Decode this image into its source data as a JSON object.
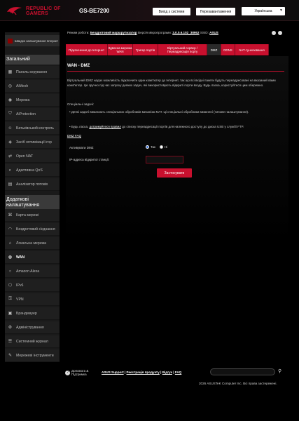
{
  "header": {
    "brand_line1": "REPUBLIC OF",
    "brand_line2": "GAMERS",
    "model": "GS-BE7200",
    "logout": "Вихід з системи",
    "reboot": "Перезавантаження",
    "language": "Українська"
  },
  "info": {
    "mode_label": "Режим роботи:",
    "mode_value": "Бездротовий маршрутизатор",
    "firmware_label": "Версія мікропрограми:",
    "firmware_value": "3.0.0.6.102_38952",
    "ssid_label": "SSID:",
    "ssid_value": "ASUS"
  },
  "sidebar": {
    "quick_setup": "Швидке налаштування Інтернет",
    "general_title": "Загальний",
    "general": [
      {
        "label": "Панель керування",
        "icon": "dashboard-icon"
      },
      {
        "label": "AiMesh",
        "icon": "aimesh-icon"
      },
      {
        "label": "Мережа",
        "icon": "network-icon"
      },
      {
        "label": "AiProtection",
        "icon": "shield-icon"
      },
      {
        "label": "Батьківський контроль",
        "icon": "parental-icon"
      },
      {
        "label": "Засіб оптимізації ігор",
        "icon": "gamepad-icon"
      },
      {
        "label": "Open NAT",
        "icon": "nat-icon"
      },
      {
        "label": "Адаптивна QoS",
        "icon": "qos-icon"
      },
      {
        "label": "Аналізатор потоків",
        "icon": "traffic-icon"
      }
    ],
    "advanced_title": "Додаткові налаштування",
    "advanced": [
      {
        "label": "Карта мережі",
        "icon": "map-icon"
      },
      {
        "label": "Бездротовий з'єднання",
        "icon": "wifi-icon"
      },
      {
        "label": "Локальна мережа",
        "icon": "lan-icon"
      },
      {
        "label": "WAN",
        "icon": "globe-icon",
        "active": true
      },
      {
        "label": "Amazon Alexa",
        "icon": "alexa-icon"
      },
      {
        "label": "IPv6",
        "icon": "ipv6-icon"
      },
      {
        "label": "VPN",
        "icon": "vpn-icon"
      },
      {
        "label": "Брандмауер",
        "icon": "firewall-icon"
      },
      {
        "label": "Адміністрування",
        "icon": "admin-icon"
      },
      {
        "label": "Системний журнал",
        "icon": "log-icon"
      },
      {
        "label": "Мережеві інструменти",
        "icon": "tools-icon"
      }
    ]
  },
  "tabs": [
    {
      "label": "Підключення до Інтернет"
    },
    {
      "label": "Здвоєна мережа WAN"
    },
    {
      "label": "Тригер портів"
    },
    {
      "label": "Віртуальний сервер / Переадресація порту"
    },
    {
      "label": "DMZ",
      "active": true
    },
    {
      "label": "DDNS"
    },
    {
      "label": "NAT-тунелювання"
    }
  ],
  "content": {
    "title": "WAN - DMZ",
    "description": "Віртуальний DMZ надає можливість підключити один комп'ютер до Інтернет, так що всі вхідні пакети будуть переадресовані на вказаний вами комп'ютер. Це зручно під час запуску деяких задач, які використовують відкриті порти входу. Будь ласка, користуйтеся цим обережно.",
    "special_title": "Спеціальні задачі:",
    "bullet1": "Деякі задачі вимагають спеціальних обробників механізм NAT. Ці спеціальні обробники вимкнені (типове налаштування).",
    "bullet2_pre": "Будь ласка,",
    "bullet2_link": "дотримуйтеся правил",
    "bullet2_post": "до списку переадресації портів для належного доступу до диска USB у службі FTP.",
    "faq": "DMZ FAQ",
    "enable_label": "Активувати DMZ",
    "yes": "Так",
    "no": "Ні",
    "ip_label": "IP-адреса відкритої станції:",
    "ip_value": "",
    "apply": "Застосувати"
  },
  "footer": {
    "help": "Допомога & Підтримка",
    "links": [
      "ASUS Support",
      "Реєстрація продукту",
      "Відгук",
      "FAQ"
    ],
    "search_placeholder": "",
    "copyright": "2026 ASUSTeK Computer Inc. Всі права застережені."
  }
}
